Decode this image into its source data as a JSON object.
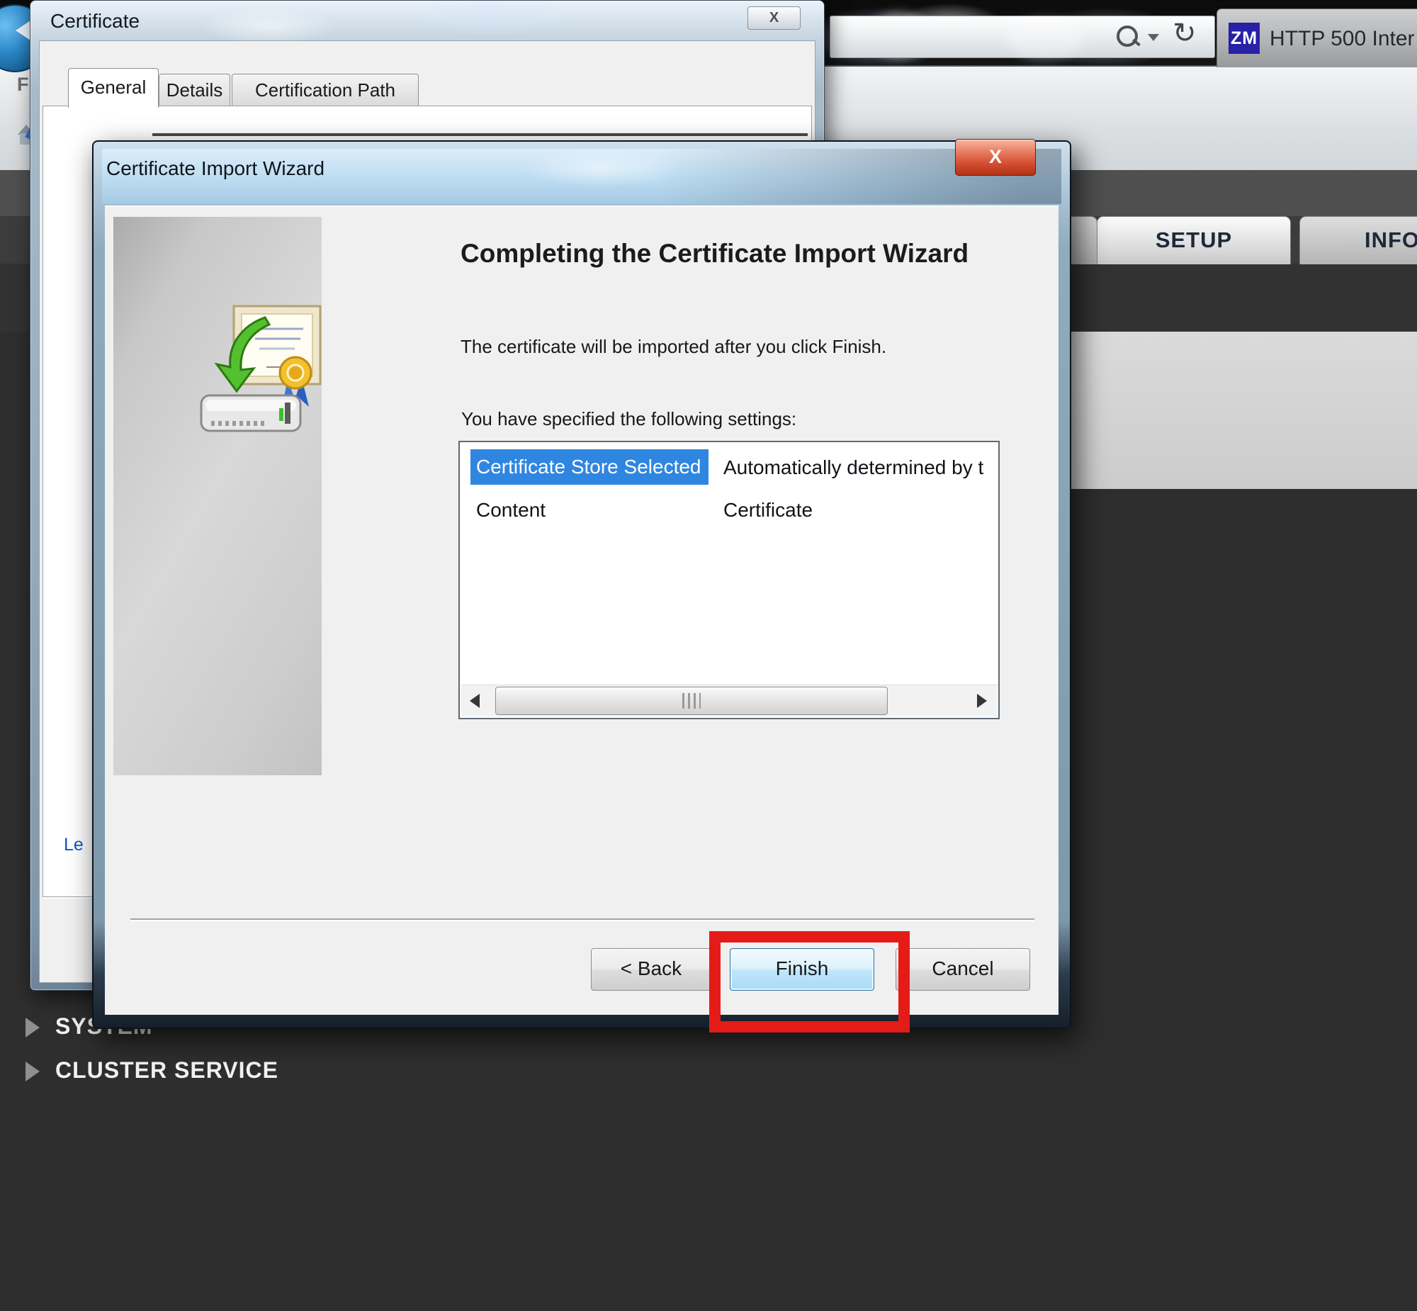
{
  "browser": {
    "tab": {
      "favicon": "ZM",
      "title": "HTTP 500 Inter"
    },
    "refresh_glyph": "↻",
    "favorites_letter": "F"
  },
  "background_page": {
    "tabs": [
      {
        "label": "SETUP"
      },
      {
        "label": "INFO"
      }
    ],
    "sections": [
      {
        "label": "SYSTEM"
      },
      {
        "label": "CLUSTER SERVICE"
      }
    ]
  },
  "certificate_dialog": {
    "title": "Certificate",
    "close_label": "X",
    "tabs": [
      "General",
      "Details",
      "Certification Path"
    ],
    "link_fragment": "Le"
  },
  "wizard": {
    "title": "Certificate Import Wizard",
    "close_label": "X",
    "heading": "Completing the Certificate Import Wizard",
    "description": "The certificate will be imported after you click Finish.",
    "settings_label": "You have specified the following settings:",
    "settings": [
      {
        "name": "Certificate Store Selected",
        "value": "Automatically determined by t",
        "selected": true
      },
      {
        "name": "Content",
        "value": "Certificate",
        "selected": false
      }
    ],
    "buttons": {
      "back": "< Back",
      "finish": "Finish",
      "cancel": "Cancel"
    },
    "annotation_color": "#e51b17",
    "selection_color": "#2f86e0"
  }
}
